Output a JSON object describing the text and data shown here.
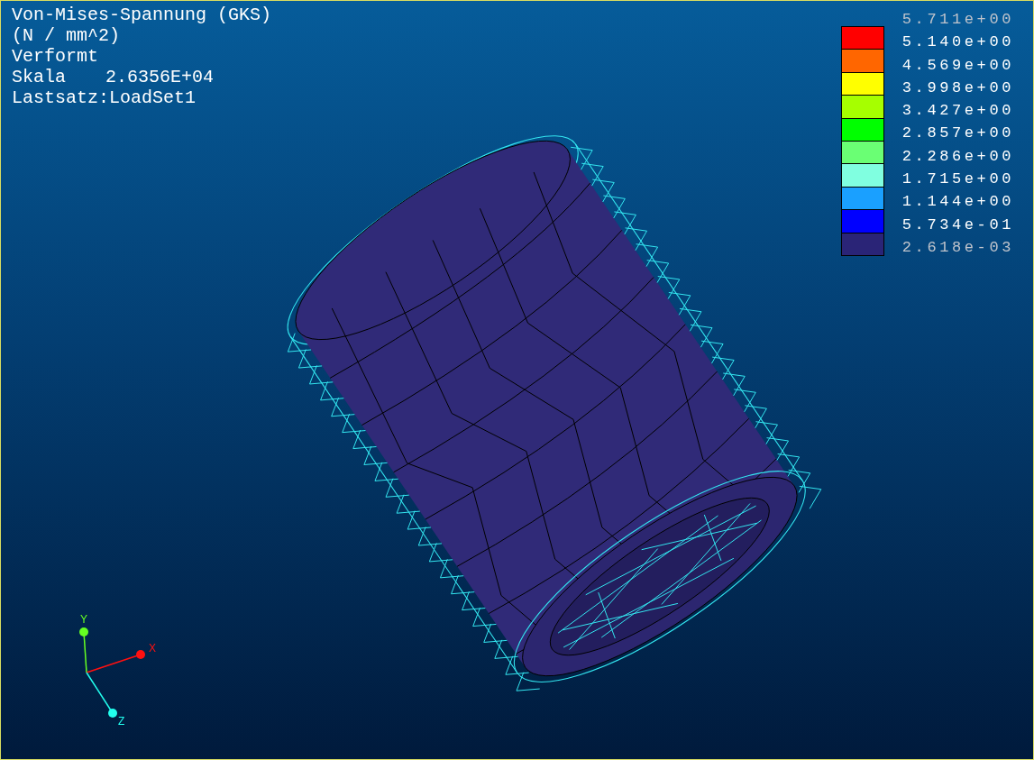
{
  "info": {
    "lines": [
      "Von-Mises-Spannung (GKS)",
      "(N / mm^2)",
      "Verformt"
    ],
    "scale_label": "Skala",
    "scale_value": "2.6356E+04",
    "load_set": "Lastsatz:LoadSet1"
  },
  "legend": {
    "labels": [
      {
        "text": "5.711e+00",
        "dimmed": true
      },
      {
        "text": "5.140e+00",
        "dimmed": false
      },
      {
        "text": "4.569e+00",
        "dimmed": false
      },
      {
        "text": "3.998e+00",
        "dimmed": false
      },
      {
        "text": "3.427e+00",
        "dimmed": false
      },
      {
        "text": "2.857e+00",
        "dimmed": false
      },
      {
        "text": "2.286e+00",
        "dimmed": false
      },
      {
        "text": "1.715e+00",
        "dimmed": false
      },
      {
        "text": "1.144e+00",
        "dimmed": false
      },
      {
        "text": "5.734e-01",
        "dimmed": false
      },
      {
        "text": "2.618e-03",
        "dimmed": true
      }
    ],
    "bands": [
      {
        "color": "#ff0000"
      },
      {
        "color": "#ff6600"
      },
      {
        "color": "#ffff00"
      },
      {
        "color": "#a6ff00"
      },
      {
        "color": "#00ff00"
      },
      {
        "color": "#6aff74"
      },
      {
        "color": "#80ffe0"
      },
      {
        "color": "#1aa0ff"
      },
      {
        "color": "#0000ff"
      },
      {
        "color": "#2a2477"
      }
    ]
  },
  "axes": [
    {
      "label": "Y",
      "color": "#66ff22"
    },
    {
      "label": "X",
      "color": "#ff1010"
    },
    {
      "label": "Z",
      "color": "#22ffee"
    }
  ]
}
